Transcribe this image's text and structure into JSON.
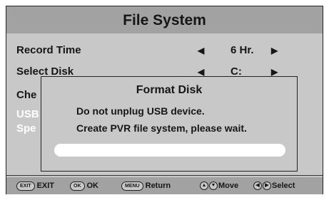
{
  "screen_title": "File System",
  "menu": [
    {
      "label": "Record Time",
      "value": "6 Hr.",
      "arrow_left": "◀",
      "arrow_right": "▶"
    },
    {
      "label": "Select Disk",
      "value": "C:",
      "arrow_left": "◀",
      "arrow_right": "▶"
    },
    {
      "label": "Che",
      "value": "",
      "arrow_left": "",
      "arrow_right": ""
    },
    {
      "label": "USB",
      "value": "",
      "arrow_left": "",
      "arrow_right": ""
    },
    {
      "label": "Spe",
      "value": "",
      "arrow_left": "",
      "arrow_right": ""
    }
  ],
  "dialog": {
    "title": "Format Disk",
    "line1": "Do not unplug USB device.",
    "line2": "Create PVR file system, please wait.",
    "progress": 0
  },
  "footer": {
    "exit_key": "EXIT",
    "exit_label": "EXIT",
    "ok_key": "OK",
    "ok_label": "OK",
    "menu_key": "MENU",
    "menu_label": "Return",
    "move_icon_1": "▲",
    "move_icon_2": "▼",
    "move_label": "Move",
    "select_icon_1": "◀",
    "select_icon_2": "▶",
    "select_label": "Select"
  }
}
